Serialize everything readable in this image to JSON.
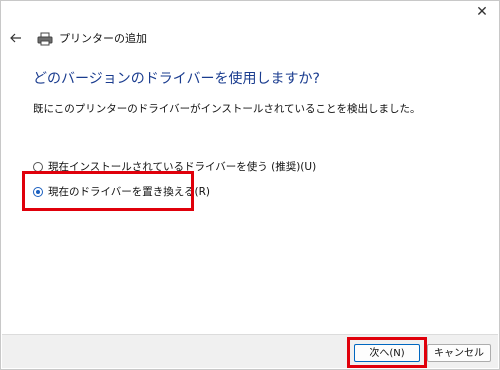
{
  "window": {
    "close_glyph": "✕",
    "header_title": "プリンターの追加"
  },
  "main": {
    "title": "どのバージョンのドライバーを使用しますか?",
    "description": "既にこのプリンターのドライバーがインストールされていることを検出しました。",
    "options": [
      {
        "label": "現在インストールされているドライバーを使う (推奨)(U)",
        "selected": false
      },
      {
        "label": "現在のドライバーを置き換える(R)",
        "selected": true
      }
    ]
  },
  "footer": {
    "next_label": "次へ(N)",
    "cancel_label": "キャンセル"
  },
  "colors": {
    "title": "#1a3c8f",
    "highlight": "#e0000b",
    "accent": "#1a5fbf"
  }
}
